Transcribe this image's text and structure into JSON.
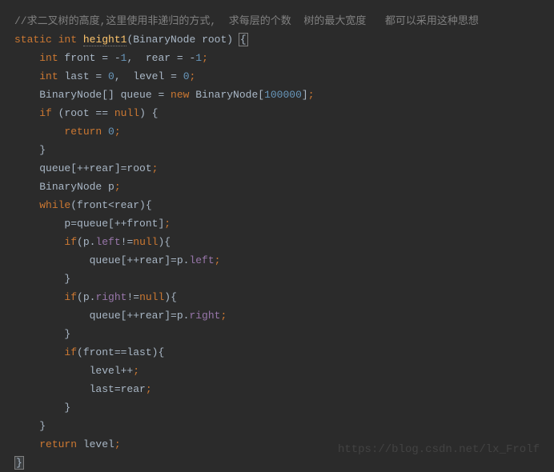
{
  "code": {
    "line1_comment": "//求二叉树的高度,这里使用非递归的方式,  求每层的个数  树的最大宽度   都可以采用这种思想",
    "line2_static": "static",
    "line2_int": "int",
    "line2_method": "height1",
    "line2_params": "(BinaryNode root) ",
    "line2_brace": "{",
    "line3_int": "int",
    "line3_rest": " front = -",
    "line3_n1": "1",
    "line3_mid": ",  rear = -",
    "line3_n2": "1",
    "line3_semi": ";",
    "line4_int": "int",
    "line4_rest": " last = ",
    "line4_n1": "0",
    "line4_mid": ",  level = ",
    "line4_n2": "0",
    "line4_semi": ";",
    "line5_a": "BinaryNode[] queue = ",
    "line5_new": "new",
    "line5_b": " BinaryNode[",
    "line5_n": "100000",
    "line5_c": "]",
    "line5_semi": ";",
    "line6_if": "if",
    "line6_a": " (root == ",
    "line6_null": "null",
    "line6_b": ") {",
    "line7_return": "return",
    "line7_sp": " ",
    "line7_n": "0",
    "line7_semi": ";",
    "line8": "}",
    "line9_a": "queue[++rear]=root",
    "line9_semi": ";",
    "line10_a": "BinaryNode p",
    "line10_semi": ";",
    "line11_while": "while",
    "line11_a": "(front<rear){",
    "line12_a": "p=queue[++front]",
    "line12_semi": ";",
    "line13_if": "if",
    "line13_a": "(p.",
    "line13_left": "left",
    "line13_b": "!=",
    "line13_null": "null",
    "line13_c": "){",
    "line14_a": "queue[++rear]=p.",
    "line14_left": "left",
    "line14_semi": ";",
    "line15": "}",
    "line16_if": "if",
    "line16_a": "(p.",
    "line16_right": "right",
    "line16_b": "!=",
    "line16_null": "null",
    "line16_c": "){",
    "line17_a": "queue[++rear]=p.",
    "line17_right": "right",
    "line17_semi": ";",
    "line18": "}",
    "line19_if": "if",
    "line19_a": "(front==last){",
    "line20_a": "level++",
    "line20_semi": ";",
    "line21_a": "last=rear",
    "line21_semi": ";",
    "line22": "}",
    "line23": "}",
    "line24_return": "return",
    "line24_a": " level",
    "line24_semi": ";",
    "line25": "}"
  },
  "watermark": "https://blog.csdn.net/lx_Frolf"
}
